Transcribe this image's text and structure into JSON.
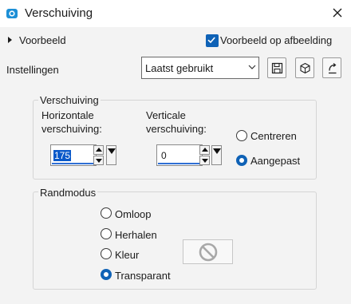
{
  "window": {
    "title": "Verschuiving"
  },
  "preview": {
    "toggle_label": "Voorbeeld",
    "checkbox_label": "Voorbeeld op afbeelding",
    "checked": true
  },
  "settings": {
    "label": "Instellingen",
    "preset_value": "Laatst gebruikt"
  },
  "offset_group": {
    "title": "Verschuiving",
    "horizontal_label_1": "Horizontale",
    "horizontal_label_2": "verschuiving:",
    "horizontal_value": "175",
    "vertical_label_1": "Verticale",
    "vertical_label_2": "verschuiving:",
    "vertical_value": "0",
    "options": [
      "Centreren",
      "Aangepast"
    ],
    "selected": "Aangepast"
  },
  "edge_group": {
    "title": "Randmodus",
    "options": [
      "Omloop",
      "Herhalen",
      "Kleur",
      "Transparant"
    ],
    "selected": "Transparant"
  },
  "colors": {
    "accent": "#0f62b6",
    "panel": "#f3f3f3",
    "selection": "#0a59c9"
  },
  "icons": [
    "app-icon",
    "close-icon",
    "save-icon",
    "cube-icon",
    "reset-icon",
    "no-symbol-icon"
  ]
}
